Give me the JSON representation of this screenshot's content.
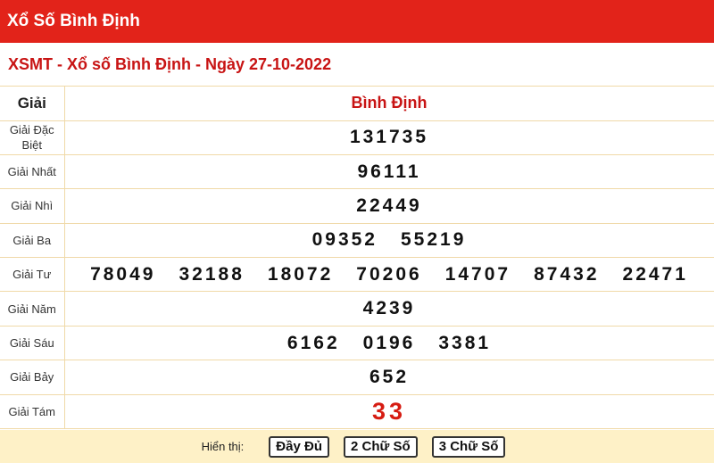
{
  "header": {
    "title": "Xổ Số Bình Định"
  },
  "subheader": {
    "title": "XSMT - Xổ số Bình Định - Ngày 27-10-2022"
  },
  "table": {
    "col_label": "Giải",
    "col_province": "Bình Định",
    "rows": [
      {
        "label": "Giải Đặc Biệt",
        "numbers": [
          "131735"
        ]
      },
      {
        "label": "Giải Nhất",
        "numbers": [
          "96111"
        ]
      },
      {
        "label": "Giải Nhì",
        "numbers": [
          "22449"
        ]
      },
      {
        "label": "Giải Ba",
        "numbers": [
          "09352",
          "55219"
        ]
      },
      {
        "label": "Giải Tư",
        "numbers": [
          "78049",
          "32188",
          "18072",
          "70206",
          "14707",
          "87432",
          "22471"
        ]
      },
      {
        "label": "Giải Năm",
        "numbers": [
          "4239"
        ]
      },
      {
        "label": "Giải Sáu",
        "numbers": [
          "6162",
          "0196",
          "3381"
        ]
      },
      {
        "label": "Giải Bảy",
        "numbers": [
          "652"
        ]
      },
      {
        "label": "Giải Tám",
        "numbers": [
          "33"
        ],
        "highlight": true
      }
    ]
  },
  "footer": {
    "label": "Hiển thị:",
    "buttons": [
      "Đầy Đủ",
      "2 Chữ Số",
      "3 Chữ Số"
    ]
  },
  "colors": {
    "brand_red": "#e2231a",
    "title_red": "#c81414",
    "number_red": "#d61c12",
    "footer_bg": "#fef1c7"
  }
}
